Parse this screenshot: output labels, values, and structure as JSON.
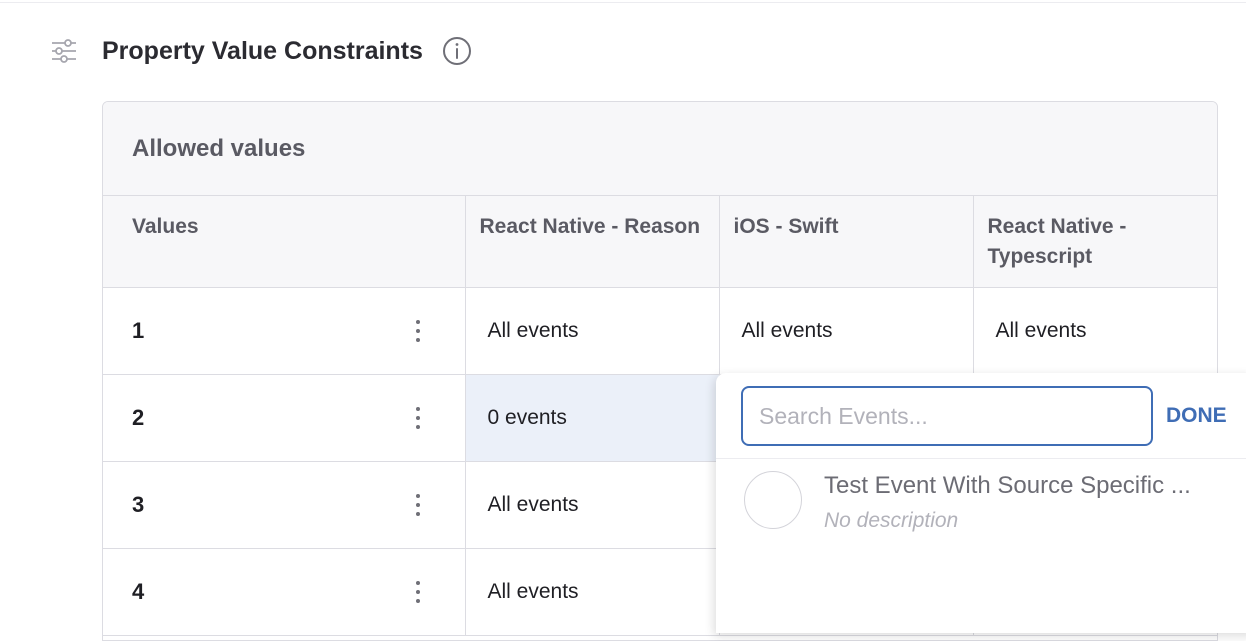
{
  "section": {
    "title": "Property Value Constraints",
    "settings_icon": "sliders-icon",
    "info_icon": "info-icon"
  },
  "allowed_values": {
    "title": "Allowed values",
    "columns": [
      "Values",
      "React Native - Reason",
      "iOS - Swift",
      "React Native - Typescript"
    ],
    "rows": [
      {
        "value": "1",
        "cells": [
          "All events",
          "All events",
          "All events"
        ]
      },
      {
        "value": "2",
        "cells": [
          "0 events",
          "",
          ""
        ]
      },
      {
        "value": "3",
        "cells": [
          "All events",
          "",
          ""
        ]
      },
      {
        "value": "4",
        "cells": [
          "All events",
          "",
          ""
        ]
      }
    ]
  },
  "event_picker": {
    "search_value": "",
    "search_placeholder": "Search Events...",
    "done_label": "DONE",
    "options": [
      {
        "name": "Test Event With Source Specific ...",
        "description": "No description",
        "selected": false
      }
    ]
  },
  "colors": {
    "accent": "#3f6db5",
    "selected_cell_bg": "#ebf0f9",
    "header_bg": "#f7f7f9",
    "border": "#dcdce2"
  }
}
